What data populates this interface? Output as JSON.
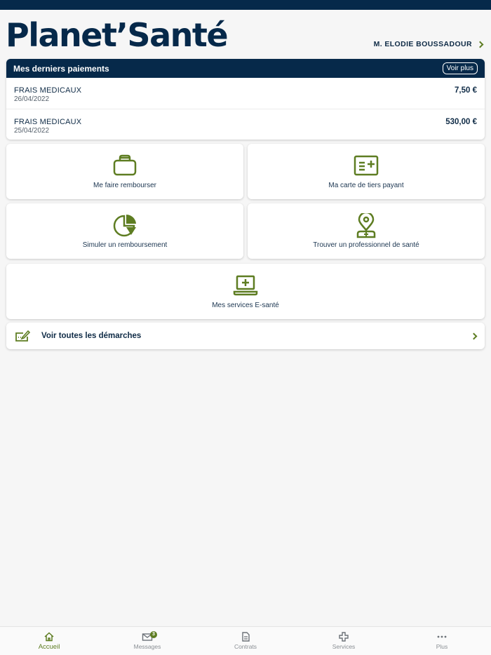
{
  "app": {
    "logo_text": "Planet’Santé"
  },
  "user": {
    "name": "M. ELODIE BOUSSADOUR"
  },
  "payments": {
    "title": "Mes derniers paiements",
    "see_more": "Voir plus",
    "rows": [
      {
        "label": "FRAIS MEDICAUX",
        "date": "26/04/2022",
        "amount": "7,50 €"
      },
      {
        "label": "FRAIS MEDICAUX",
        "date": "25/04/2022",
        "amount": "530,00 €"
      }
    ]
  },
  "tiles": {
    "reimburse": {
      "label": "Me faire rembourser",
      "icon": "bag-icon"
    },
    "card": {
      "label": "Ma carte de tiers payant",
      "icon": "card-icon"
    },
    "simulate": {
      "label": "Simuler un remboursement",
      "icon": "pie-chart-icon"
    },
    "find": {
      "label": "Trouver un professionnel de santé",
      "icon": "location-doctor-icon"
    },
    "eservices": {
      "label": "Mes services E-santé",
      "icon": "laptop-plus-icon"
    }
  },
  "all_steps": {
    "label": "Voir toutes les démarches",
    "icon": "sign-form-icon"
  },
  "tabbar": {
    "home": "Accueil",
    "messages": "Messages",
    "messages_badge": "3",
    "contracts": "Contrats",
    "services": "Services",
    "more": "Plus"
  },
  "colors": {
    "navy": "#06294a",
    "accent_green": "#5e7d22",
    "background": "#f6f6f6"
  }
}
